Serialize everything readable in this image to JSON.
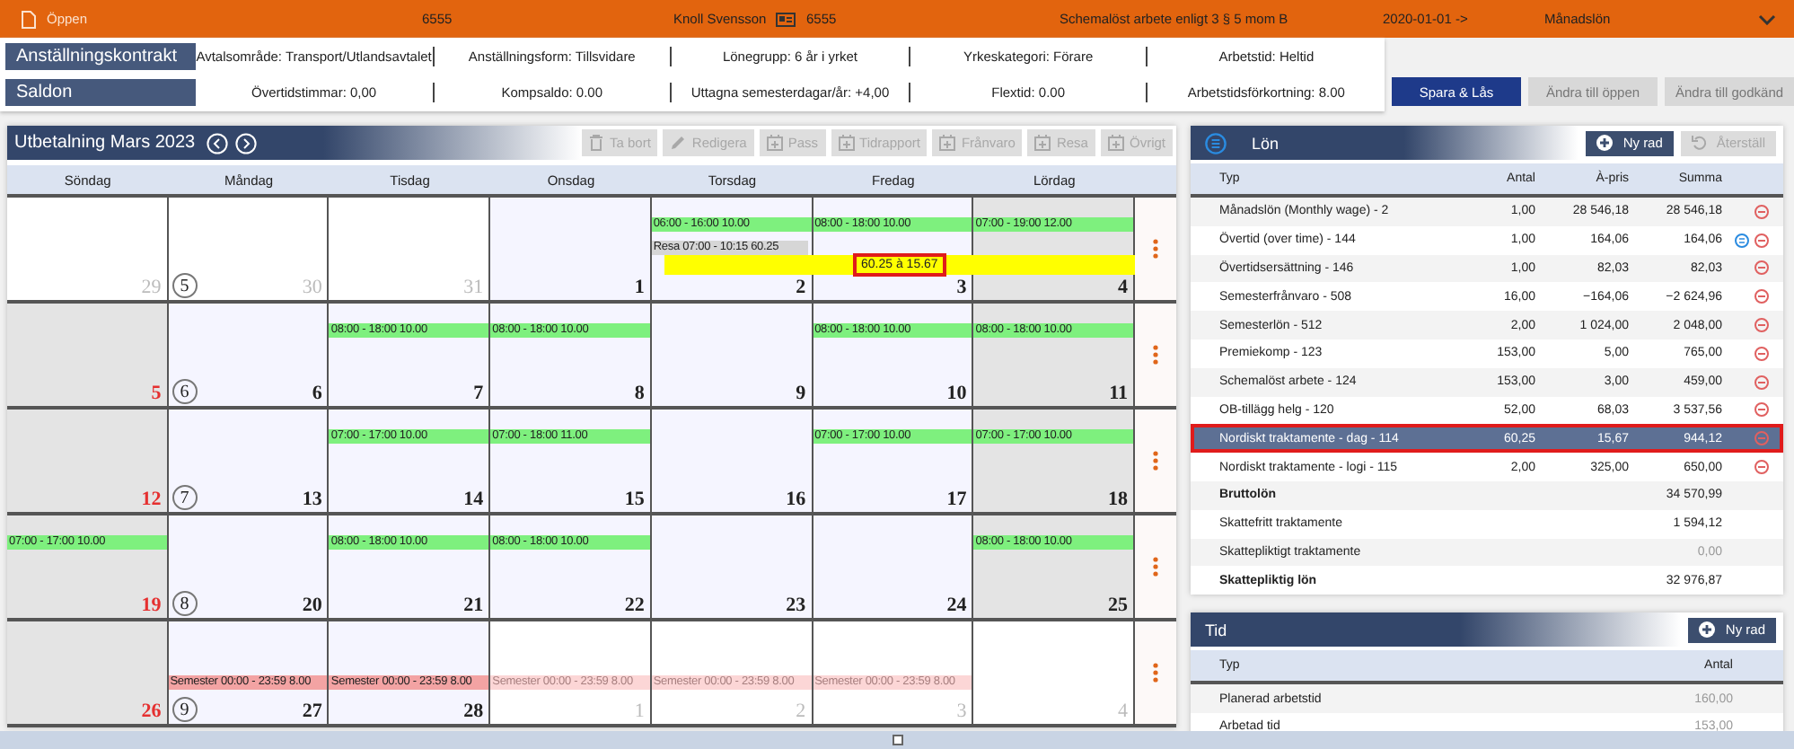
{
  "header": {
    "items": [
      {
        "kind": "status",
        "text": "Öppen"
      },
      {
        "kind": "text",
        "text": "6555"
      },
      {
        "kind": "text",
        "text": "Knoll Svensson"
      },
      {
        "kind": "card",
        "text": "6555"
      },
      {
        "kind": "text",
        "text": "Schemalöst arbete enligt 3 § 5 mom B"
      },
      {
        "kind": "text",
        "text": "2020-01-01 ->"
      },
      {
        "kind": "text",
        "text": "Månadslön"
      }
    ]
  },
  "contract": {
    "title": "Anställningskontrakt",
    "fields": [
      "Avtalsområde: Transport/Utlandsavtalet",
      "Anställningsform: Tillsvidare",
      "Lönegrupp: 6 år i yrket",
      "Yrkeskategori: Förare",
      "Arbetstid: Heltid"
    ]
  },
  "balances": {
    "title": "Saldon",
    "fields": [
      "Övertidstimmar: 0,00",
      "Kompsaldo: 0.00",
      "Uttagna semesterdagar/år: +4,00",
      "Flextid: 0.00",
      "Arbetstidsförkortning: 8.00"
    ]
  },
  "actions": [
    {
      "label": "Spara & Lås",
      "disabled": false
    },
    {
      "label": "Ändra till öppen",
      "disabled": true
    },
    {
      "label": "Ändra till godkänd",
      "disabled": true
    }
  ],
  "calendar": {
    "title": "Utbetalning Mars 2023",
    "toolbar": [
      {
        "label": "Ta bort",
        "disabled": true
      },
      {
        "label": "Redigera",
        "disabled": true
      },
      {
        "label": "Pass",
        "disabled": true
      },
      {
        "label": "Tidrapport",
        "disabled": true
      },
      {
        "label": "Frånvaro",
        "disabled": true
      },
      {
        "label": "Resa",
        "disabled": true
      },
      {
        "label": "Övrigt",
        "disabled": true
      }
    ],
    "weekdays": [
      "Söndag",
      "Måndag",
      "Tisdag",
      "Onsdag",
      "Torsdag",
      "Fredag",
      "Lördag"
    ],
    "weeks": [
      {
        "number": "5",
        "overlay": {
          "text": "60.25 à 15.67",
          "highlighted": true
        },
        "days": [
          {
            "date": "29",
            "other_month": true,
            "weekend": false,
            "red": false
          },
          {
            "date": "30",
            "other_month": true,
            "weekend": false,
            "red": false
          },
          {
            "date": "31",
            "other_month": true,
            "weekend": false,
            "red": false
          },
          {
            "date": "1",
            "other_month": false,
            "weekend": false,
            "red": false
          },
          {
            "date": "2",
            "other_month": false,
            "weekend": false,
            "red": false,
            "events": [
              {
                "kind": "shift",
                "text": "06:00 - 16:00 10.00"
              },
              {
                "kind": "trip",
                "text": "Resa 07:00 - 10:15 60.25"
              }
            ]
          },
          {
            "date": "3",
            "other_month": false,
            "weekend": false,
            "red": false,
            "events": [
              {
                "kind": "shift",
                "text": "08:00 - 18:00 10.00"
              }
            ]
          },
          {
            "date": "4",
            "other_month": false,
            "weekend": true,
            "red": false,
            "events": [
              {
                "kind": "shift",
                "text": "07:00 - 19:00 12.00"
              }
            ]
          }
        ]
      },
      {
        "number": "6",
        "days": [
          {
            "date": "5",
            "other_month": false,
            "weekend": true,
            "red": true
          },
          {
            "date": "6",
            "other_month": false,
            "weekend": false,
            "red": false
          },
          {
            "date": "7",
            "other_month": false,
            "weekend": false,
            "red": false,
            "events": [
              {
                "kind": "shift",
                "text": "08:00 - 18:00 10.00"
              }
            ]
          },
          {
            "date": "8",
            "other_month": false,
            "weekend": false,
            "red": false,
            "events": [
              {
                "kind": "shift",
                "text": "08:00 - 18:00 10.00"
              }
            ]
          },
          {
            "date": "9",
            "other_month": false,
            "weekend": false,
            "red": false
          },
          {
            "date": "10",
            "other_month": false,
            "weekend": false,
            "red": false,
            "events": [
              {
                "kind": "shift",
                "text": "08:00 - 18:00 10.00"
              }
            ]
          },
          {
            "date": "11",
            "other_month": false,
            "weekend": true,
            "red": false,
            "events": [
              {
                "kind": "shift",
                "text": "08:00 - 18:00 10.00"
              }
            ]
          }
        ]
      },
      {
        "number": "7",
        "days": [
          {
            "date": "12",
            "other_month": false,
            "weekend": true,
            "red": true
          },
          {
            "date": "13",
            "other_month": false,
            "weekend": false,
            "red": false
          },
          {
            "date": "14",
            "other_month": false,
            "weekend": false,
            "red": false,
            "events": [
              {
                "kind": "shift",
                "text": "07:00 - 17:00 10.00"
              }
            ]
          },
          {
            "date": "15",
            "other_month": false,
            "weekend": false,
            "red": false,
            "events": [
              {
                "kind": "shift",
                "text": "07:00 - 18:00 11.00"
              }
            ]
          },
          {
            "date": "16",
            "other_month": false,
            "weekend": false,
            "red": false
          },
          {
            "date": "17",
            "other_month": false,
            "weekend": false,
            "red": false,
            "events": [
              {
                "kind": "shift",
                "text": "07:00 - 17:00 10.00"
              }
            ]
          },
          {
            "date": "18",
            "other_month": false,
            "weekend": true,
            "red": false,
            "events": [
              {
                "kind": "shift",
                "text": "07:00 - 17:00 10.00"
              }
            ]
          }
        ]
      },
      {
        "number": "8",
        "days": [
          {
            "date": "19",
            "other_month": false,
            "weekend": true,
            "red": true,
            "events": [
              {
                "kind": "shift",
                "text": "07:00 - 17:00 10.00"
              }
            ]
          },
          {
            "date": "20",
            "other_month": false,
            "weekend": false,
            "red": false
          },
          {
            "date": "21",
            "other_month": false,
            "weekend": false,
            "red": false,
            "events": [
              {
                "kind": "shift",
                "text": "08:00 - 18:00 10.00"
              }
            ]
          },
          {
            "date": "22",
            "other_month": false,
            "weekend": false,
            "red": false,
            "events": [
              {
                "kind": "shift",
                "text": "08:00 - 18:00 10.00"
              }
            ]
          },
          {
            "date": "23",
            "other_month": false,
            "weekend": false,
            "red": false
          },
          {
            "date": "24",
            "other_month": false,
            "weekend": false,
            "red": false
          },
          {
            "date": "25",
            "other_month": false,
            "weekend": true,
            "red": false,
            "events": [
              {
                "kind": "shift",
                "text": "08:00 - 18:00 10.00"
              }
            ]
          }
        ]
      },
      {
        "number": "9",
        "days": [
          {
            "date": "26",
            "other_month": false,
            "weekend": true,
            "red": true
          },
          {
            "date": "27",
            "other_month": false,
            "weekend": false,
            "red": false,
            "events": [
              {
                "kind": "absence",
                "text": "Semester 00:00 - 23:59 8.00"
              }
            ]
          },
          {
            "date": "28",
            "other_month": false,
            "weekend": false,
            "red": false,
            "events": [
              {
                "kind": "absence",
                "text": "Semester 00:00 - 23:59 8.00"
              }
            ]
          },
          {
            "date": "1",
            "other_month": true,
            "weekend": false,
            "red": false,
            "events": [
              {
                "kind": "absence",
                "text": "Semester 00:00 - 23:59 8.00"
              }
            ]
          },
          {
            "date": "2",
            "other_month": true,
            "weekend": false,
            "red": false,
            "events": [
              {
                "kind": "absence",
                "text": "Semester 00:00 - 23:59 8.00"
              }
            ]
          },
          {
            "date": "3",
            "other_month": true,
            "weekend": false,
            "red": false,
            "events": [
              {
                "kind": "absence",
                "text": "Semester 00:00 - 23:59 8.00"
              }
            ]
          },
          {
            "date": "4",
            "other_month": true,
            "weekend": false,
            "red": false
          }
        ]
      }
    ]
  },
  "salary": {
    "title": "Lön",
    "add_label": "Ny rad",
    "reset_label": "Återställ",
    "reset_disabled": true,
    "columns": [
      "Typ",
      "Antal",
      "À-pris",
      "Summa"
    ],
    "rows": [
      {
        "type": "Månadslön (Monthly wage) - 2",
        "quantity": "1,00",
        "price": "28 546,18",
        "sum": "28 546,18",
        "note": false,
        "selected": false
      },
      {
        "type": "Övertid (over time) - 144",
        "quantity": "1,00",
        "price": "164,06",
        "sum": "164,06",
        "note": true,
        "selected": false
      },
      {
        "type": "Övertidsersättning - 146",
        "quantity": "1,00",
        "price": "82,03",
        "sum": "82,03",
        "note": false,
        "selected": false
      },
      {
        "type": "Semesterfrånvaro - 508",
        "quantity": "16,00",
        "price": "−164,06",
        "sum": "−2 624,96",
        "note": false,
        "selected": false
      },
      {
        "type": "Semesterlön - 512",
        "quantity": "2,00",
        "price": "1 024,00",
        "sum": "2 048,00",
        "note": false,
        "selected": false
      },
      {
        "type": "Premiekomp - 123",
        "quantity": "153,00",
        "price": "5,00",
        "sum": "765,00",
        "note": false,
        "selected": false
      },
      {
        "type": "Schemalöst arbete - 124",
        "quantity": "153,00",
        "price": "3,00",
        "sum": "459,00",
        "note": false,
        "selected": false
      },
      {
        "type": "OB-tillägg helg - 120",
        "quantity": "52,00",
        "price": "68,03",
        "sum": "3 537,56",
        "note": false,
        "selected": false
      },
      {
        "type": "Nordiskt traktamente - dag - 114",
        "quantity": "60,25",
        "price": "15,67",
        "sum": "944,12",
        "note": false,
        "selected": true
      },
      {
        "type": "Nordiskt traktamente - logi - 115",
        "quantity": "2,00",
        "price": "325,00",
        "sum": "650,00",
        "note": false,
        "selected": false
      }
    ],
    "totals": [
      {
        "label": "Bruttolön",
        "value": "34 570,99",
        "bold": true,
        "muted": false
      },
      {
        "label": "Skattefritt traktamente",
        "value": "1 594,12",
        "bold": false,
        "muted": false
      },
      {
        "label": "Skattepliktigt traktamente",
        "value": "0,00",
        "bold": false,
        "muted": true
      },
      {
        "label": "Skattepliktig lön",
        "value": "32 976,87",
        "bold": true,
        "muted": false
      }
    ]
  },
  "time": {
    "title": "Tid",
    "add_label": "Ny rad",
    "columns": [
      "Typ",
      "Antal"
    ],
    "rows": [
      {
        "type": "Planerad arbetstid",
        "value": "160,00"
      },
      {
        "type": "Arbetad tid",
        "value": "153,00"
      }
    ]
  }
}
